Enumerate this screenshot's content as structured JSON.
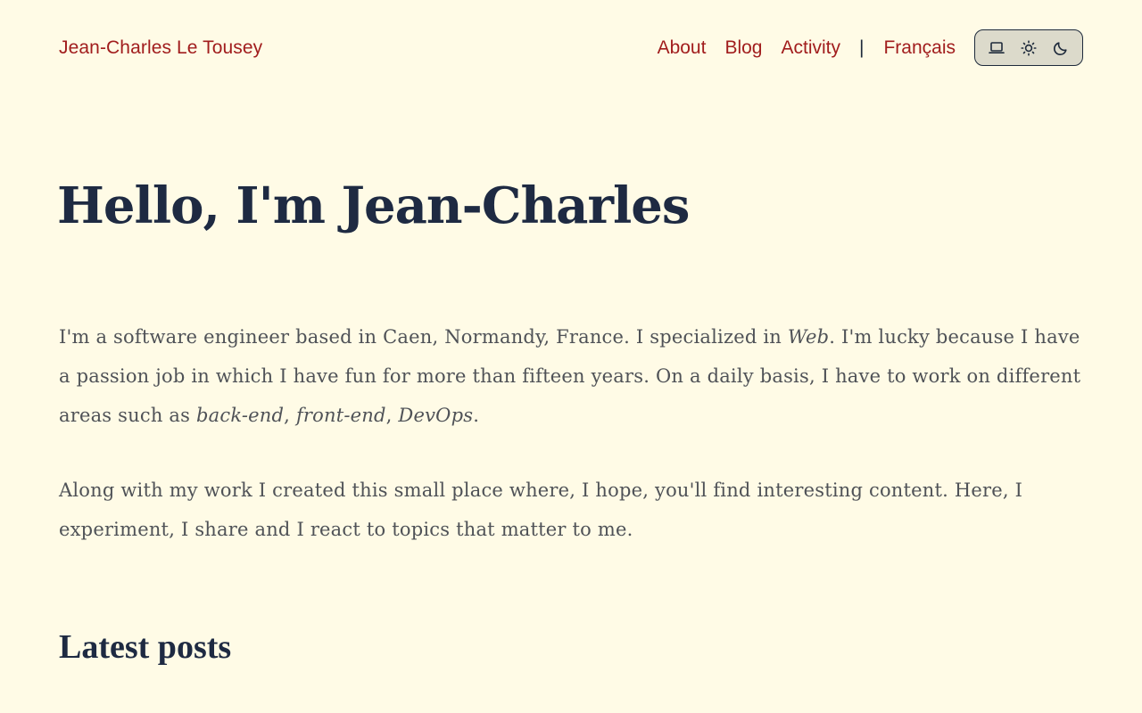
{
  "header": {
    "site_title": "Jean-Charles Le Tousey",
    "nav": {
      "about": "About",
      "blog": "Blog",
      "activity": "Activity",
      "separator": "|",
      "language": "Français"
    },
    "theme_switch": {
      "icons": [
        "laptop-icon",
        "sun-icon",
        "moon-icon"
      ]
    }
  },
  "hero": {
    "title": "Hello, I'm Jean-Charles"
  },
  "intro": {
    "p1_a": "I'm a software engineer based in Caen, Normandy, France. I specialized in ",
    "p1_web": "Web",
    "p1_b": ". I'm lucky because I have a passion job in which I have fun for more than fifteen years. On a daily basis, I have to work on different areas such as ",
    "p1_backend": "back-end",
    "p1_sep1": ", ",
    "p1_frontend": "front-end",
    "p1_sep2": ", ",
    "p1_devops": "DevOps",
    "p1_end": ".",
    "p2": "Along with my work I created this small place where, I hope, you'll find interesting content. Here, I experiment, I share and I react to topics that matter to me."
  },
  "latest_posts": {
    "title": "Latest posts"
  },
  "colors": {
    "background": "#fffbe6",
    "link": "#a11d1d",
    "heading": "#1e2a42",
    "body_text": "#4f5257"
  }
}
